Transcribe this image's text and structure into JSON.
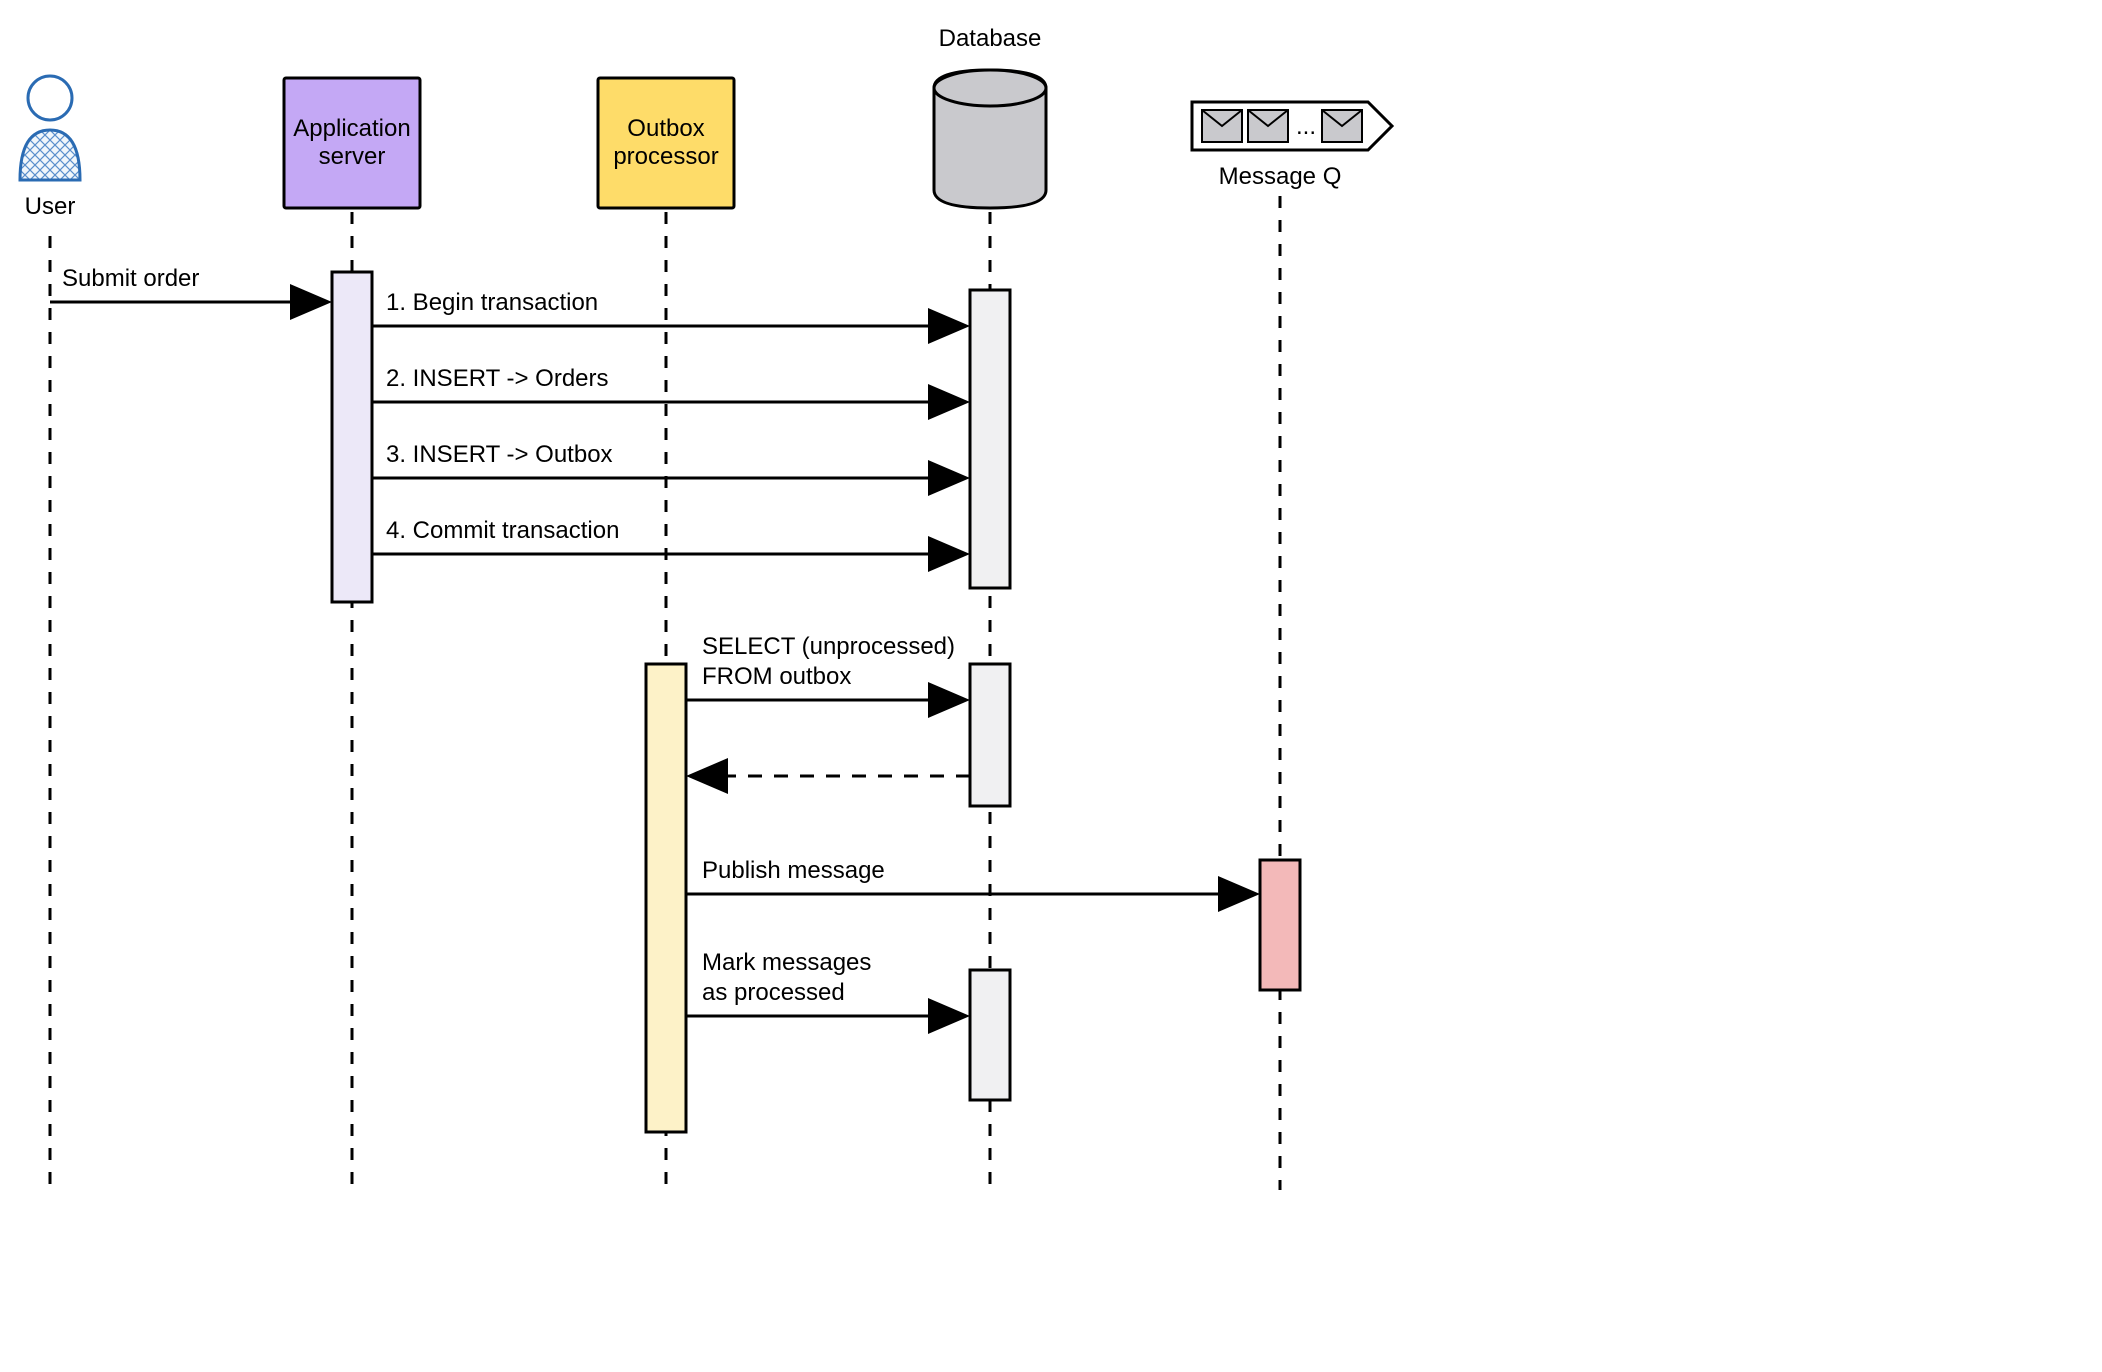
{
  "participants": {
    "user": "User",
    "appServer": "Application\nserver",
    "outbox": "Outbox\nprocessor",
    "database": "Database",
    "mq": "Message Q"
  },
  "messages": {
    "submitOrder": "Submit order",
    "begin": "1. Begin transaction",
    "insertOrders": "2. INSERT -> Orders",
    "insertOutbox": "3. INSERT -> Outbox",
    "commit": "4. Commit transaction",
    "selectL1": "SELECT (unprocessed)",
    "selectL2": "FROM outbox",
    "publish": "Publish message",
    "markL1": "Mark messages",
    "markL2": "as processed"
  },
  "colors": {
    "appServer": "#c4a8f5",
    "outbox": "#fedc69",
    "userFill": "#d6e6f5",
    "dbFill": "#c9c9cd",
    "mqFill": "#f3b9b9",
    "appActFill": "#ece8f8",
    "outboxActFill": "#fdf2c8",
    "dbActFill": "#f0f0f2"
  },
  "ellipsis": "..."
}
